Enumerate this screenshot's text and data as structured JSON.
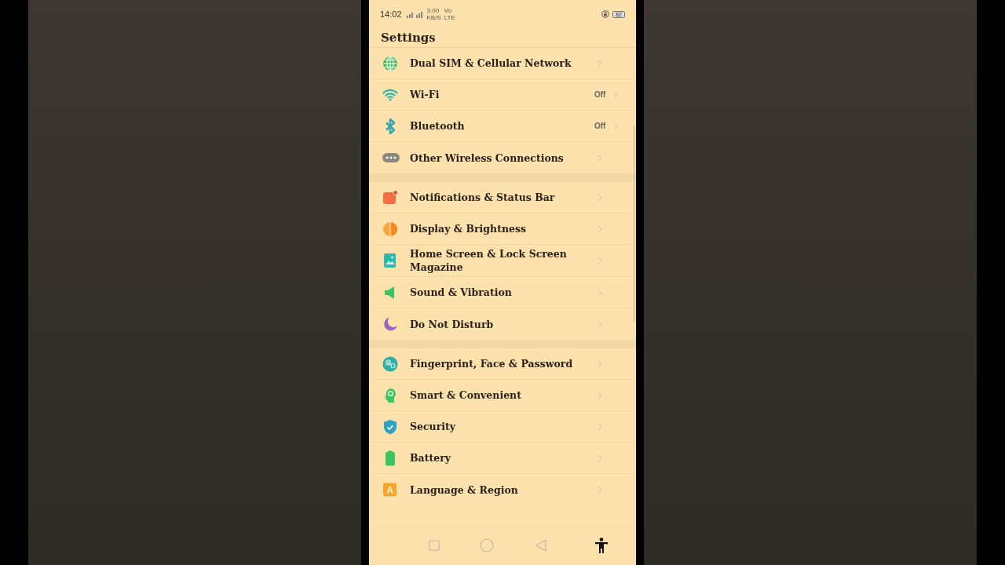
{
  "status_bar": {
    "time": "14:02",
    "speed": "3.00",
    "speed_unit": "KB/S",
    "volte": "Vo",
    "lte": "LTE",
    "battery": "82"
  },
  "header": {
    "title": "Settings"
  },
  "groups": [
    {
      "items": [
        {
          "kind": "globe",
          "label": "Dual SIM & Cellular Network"
        },
        {
          "kind": "wifi",
          "label": "Wi-Fi",
          "value": "Off"
        },
        {
          "kind": "bluetooth",
          "label": "Bluetooth",
          "value": "Off"
        },
        {
          "kind": "dots",
          "label": "Other Wireless Connections"
        }
      ]
    },
    {
      "items": [
        {
          "kind": "notification",
          "label": "Notifications & Status Bar"
        },
        {
          "kind": "halfcircle",
          "label": "Display & Brightness"
        },
        {
          "kind": "picture",
          "label": "Home Screen & Lock Screen Magazine"
        },
        {
          "kind": "speaker",
          "label": "Sound & Vibration"
        },
        {
          "kind": "moon",
          "label": "Do Not Disturb"
        }
      ]
    },
    {
      "items": [
        {
          "kind": "fingerprint",
          "label": "Fingerprint, Face & Password"
        },
        {
          "kind": "head",
          "label": "Smart & Convenient"
        },
        {
          "kind": "shield",
          "label": "Security"
        },
        {
          "kind": "battery",
          "label": "Battery"
        },
        {
          "kind": "letter",
          "icon_text": "A",
          "label": "Language & Region"
        }
      ]
    }
  ]
}
